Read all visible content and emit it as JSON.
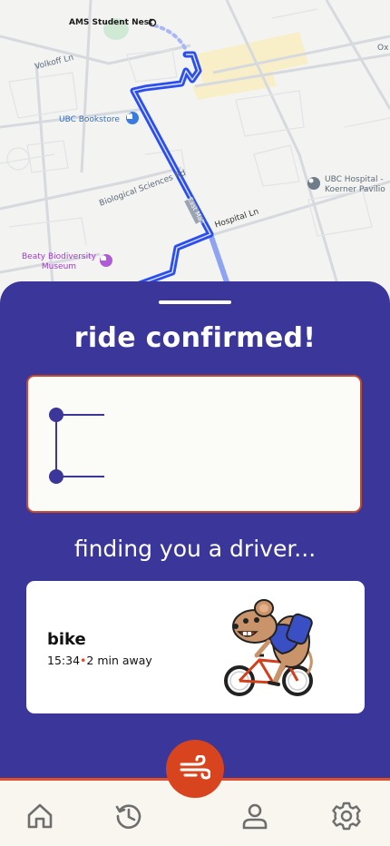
{
  "map": {
    "labels": {
      "ams": "AMS Student Nest",
      "volkoff": "Volkoff Ln",
      "ox": "Ox",
      "bookstore": "UBC Bookstore",
      "hospital_line1": "UBC Hospital -",
      "hospital_line2": "Koerner Pavilio",
      "biosci": "Biological Sciences Rd",
      "eastmall": "East Mall",
      "hospitalln": "Hospital Ln",
      "beaty_line1": "Beaty Biodiversity",
      "beaty_line2": "Museum"
    }
  },
  "sheet": {
    "title": "ride confirmed!",
    "status": "finding you a driver...",
    "ride": {
      "type": "bike",
      "time": "15:34",
      "separator": "•",
      "eta": "2 min away"
    }
  },
  "colors": {
    "sheet": "#3b3699",
    "accent": "#d8441e",
    "route": "#2a4ef0"
  },
  "nav": {
    "items": [
      "home-icon",
      "history-icon",
      "ride-wind-icon",
      "profile-icon",
      "settings-icon"
    ]
  }
}
